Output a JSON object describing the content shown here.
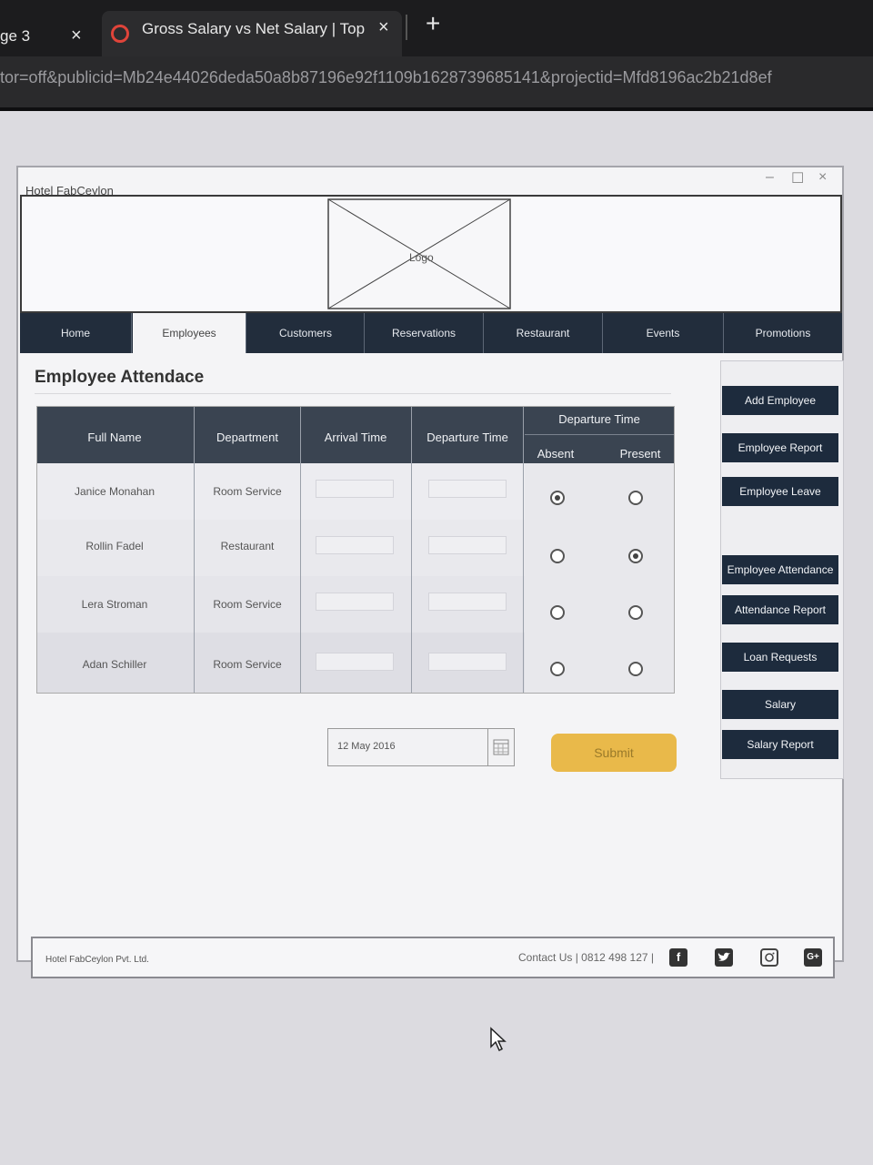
{
  "browser": {
    "prev_tab_label": "ge 3",
    "prev_tab_close": "×",
    "active_tab_title": "Gross Salary vs Net Salary | Top",
    "active_tab_close": "×",
    "new_tab": "+",
    "url": "tor=off&publicid=Mb24e44026deda50a8b87196e92f1109b1628739685141&projectid=Mfd8196ac2b21d8ef"
  },
  "window": {
    "title": "Hotel FabCeylon",
    "controls": [
      "–",
      "☐",
      "×"
    ],
    "logo_label": "Logo"
  },
  "nav": {
    "items": [
      "Home",
      "Employees",
      "Customers",
      "Reservations",
      "Restaurant",
      "Events",
      "Promotions"
    ],
    "active": "Employees"
  },
  "page": {
    "title": "Employee Attendace"
  },
  "table": {
    "headers": {
      "full_name": "Full Name",
      "department": "Department",
      "arrival_time": "Arrival Time",
      "departure_time": "Departure Time",
      "group": "Departure Time",
      "absent": "Absent",
      "present": "Present"
    },
    "rows": [
      {
        "name": "Janice Monahan",
        "department": "Room Service",
        "arrival": "",
        "departure": "",
        "status": "absent"
      },
      {
        "name": "Rollin Fadel",
        "department": "Restaurant",
        "arrival": "",
        "departure": "",
        "status": "present"
      },
      {
        "name": "Lera Stroman",
        "department": "Room Service",
        "arrival": "",
        "departure": "",
        "status": "none"
      },
      {
        "name": "Adan Schiller",
        "department": "Room Service",
        "arrival": "",
        "departure": "",
        "status": "none"
      }
    ]
  },
  "date_field": {
    "value": "12 May 2016"
  },
  "submit_label": "Submit",
  "sidebar": {
    "buttons": [
      "Add Employee",
      "Employee Report",
      "Employee Leave",
      "Employee Attendance",
      "Attendance Report",
      "Loan Requests",
      "Salary",
      "Salary Report"
    ]
  },
  "footer": {
    "brand": "Hotel FabCeylon Pvt. Ltd.",
    "contact": "Contact Us | 0812 498 127 |",
    "social_icons": [
      "facebook-icon",
      "twitter-icon",
      "instagram-icon",
      "google-plus-icon"
    ],
    "google_plus_glyph": "G+"
  },
  "colors": {
    "nav_bg": "#222d3c",
    "sidebar_btn_bg": "#1d2b3d",
    "table_header_bg": "#3a4451",
    "submit_bg": "#e9b94a"
  }
}
